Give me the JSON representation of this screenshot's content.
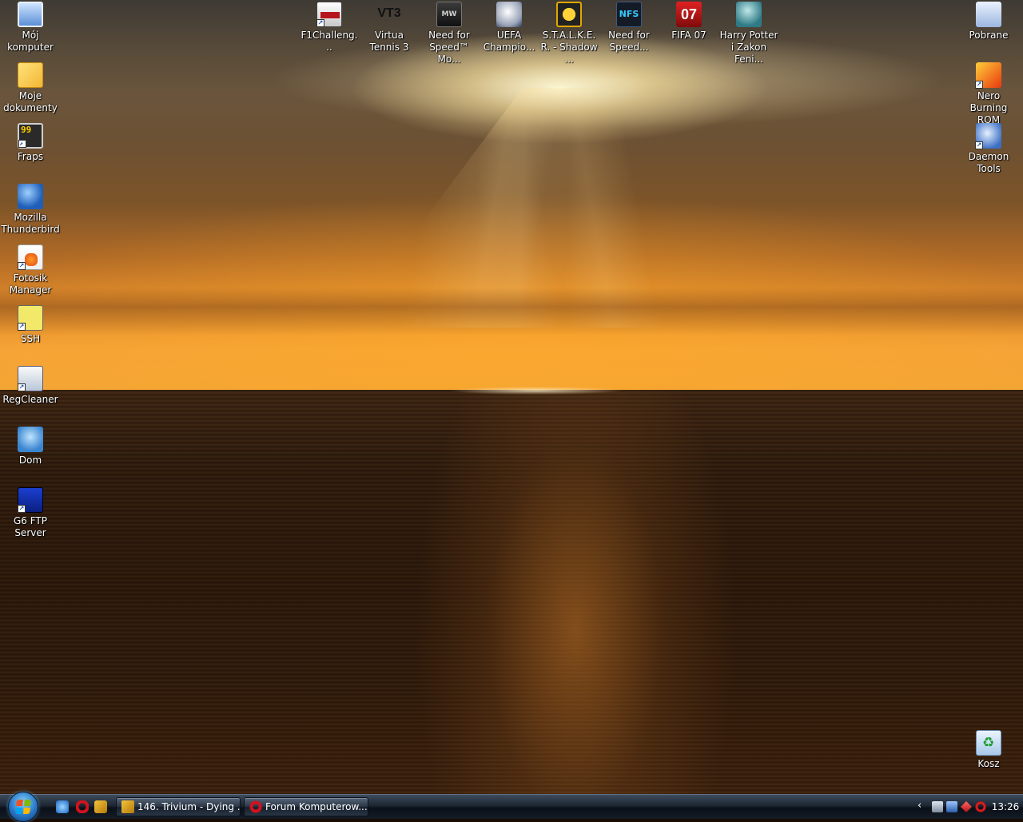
{
  "desktop": {
    "left_icons": [
      {
        "label": "Mój komputer",
        "icon": "computer-icon"
      },
      {
        "label": "Moje dokumenty",
        "icon": "documents-folder-icon"
      },
      {
        "label": "Fraps",
        "icon": "fraps-icon"
      },
      {
        "label": "Mozilla Thunderbird",
        "icon": "thunderbird-icon"
      },
      {
        "label": "Fotosik Manager",
        "icon": "fotosik-icon"
      },
      {
        "label": "SSH",
        "icon": "ssh-icon"
      },
      {
        "label": "RegCleaner",
        "icon": "regcleaner-icon"
      },
      {
        "label": "Dom",
        "icon": "network-icon"
      },
      {
        "label": "G6 FTP Server",
        "icon": "g6-ftp-icon"
      }
    ],
    "top_icons": [
      {
        "label": "F1Challeng...",
        "icon": "f1-challenge-icon"
      },
      {
        "label": "Virtua Tennis 3",
        "icon": "virtua-tennis-icon",
        "glyph_text": "VT3"
      },
      {
        "label": "Need for Speed™ Mo...",
        "icon": "nfs-most-wanted-icon",
        "glyph_text": "MW"
      },
      {
        "label": "UEFA Champio...",
        "icon": "uefa-champions-icon"
      },
      {
        "label": "S.T.A.L.K.E.R. - Shadow ...",
        "icon": "stalker-icon"
      },
      {
        "label": "Need for Speed...",
        "icon": "nfs-icon",
        "glyph_text": "NFS"
      },
      {
        "label": "FIFA 07",
        "icon": "fifa-07-icon",
        "glyph_text": "07"
      },
      {
        "label": "Harry Potter i Zakon Feni...",
        "icon": "harry-potter-icon"
      }
    ],
    "right_icons": [
      {
        "label": "Pobrane",
        "icon": "downloads-icon"
      },
      {
        "label": "Nero Burning ROM",
        "icon": "nero-icon"
      },
      {
        "label": "Daemon Tools",
        "icon": "daemon-tools-icon"
      }
    ],
    "recycle_bin": {
      "label": "Kosz",
      "icon": "recycle-bin-icon"
    }
  },
  "taskbar": {
    "quick_launch": [
      "internet-explorer-icon",
      "opera-icon",
      "winamp-icon"
    ],
    "tasks": [
      {
        "label": "146. Trivium - Dying ...",
        "icon": "winamp-icon"
      },
      {
        "label": "Forum Komputerow...",
        "icon": "opera-icon"
      }
    ],
    "tray": {
      "chevron": "‹",
      "clock": "13:26"
    }
  },
  "colors": {
    "taskbar_dark": "#0b1018",
    "sky_orange": "#f3a534",
    "sea_dark": "#2a170a"
  }
}
